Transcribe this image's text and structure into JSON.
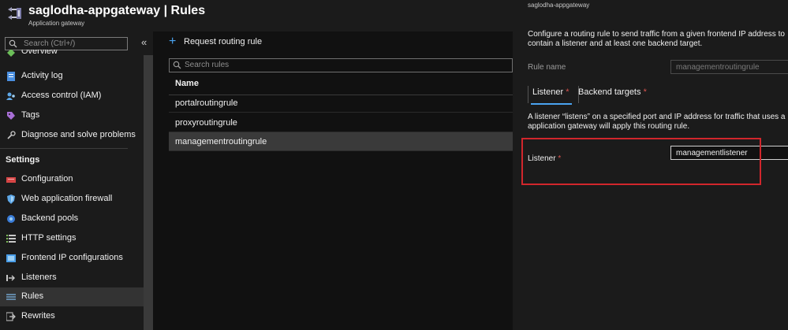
{
  "header": {
    "title": "saglodha-appgateway | Rules",
    "subtitle": "Application gateway"
  },
  "sidebar": {
    "search_placeholder": "Search (Ctrl+/)",
    "collapse_glyph": "«",
    "items": [
      {
        "label": "Overview",
        "icon": "overview-icon"
      },
      {
        "label": "Activity log",
        "icon": "activity-log-icon"
      },
      {
        "label": "Access control (IAM)",
        "icon": "iam-icon"
      },
      {
        "label": "Tags",
        "icon": "tag-icon"
      },
      {
        "label": "Diagnose and solve problems",
        "icon": "wrench-icon"
      }
    ],
    "settings_heading": "Settings",
    "settings_items": [
      {
        "label": "Configuration",
        "icon": "configuration-icon"
      },
      {
        "label": "Web application firewall",
        "icon": "shield-icon"
      },
      {
        "label": "Backend pools",
        "icon": "backend-pool-icon"
      },
      {
        "label": "HTTP settings",
        "icon": "list-settings-icon"
      },
      {
        "label": "Frontend IP configurations",
        "icon": "frontend-ip-icon"
      },
      {
        "label": "Listeners",
        "icon": "listener-icon"
      },
      {
        "label": "Rules",
        "icon": "rules-icon",
        "active": true
      },
      {
        "label": "Rewrites",
        "icon": "rewrite-icon"
      }
    ]
  },
  "main": {
    "add_button_label": "Request routing rule",
    "search_placeholder": "Search rules",
    "column_name": "Name",
    "rows": [
      {
        "name": "portalroutingrule"
      },
      {
        "name": "proxyroutingrule"
      },
      {
        "name": "managementroutingrule",
        "selected": true
      }
    ]
  },
  "panel": {
    "subtitle": "saglodha-appgateway",
    "description_line1": "Configure a routing rule to send traffic from a given frontend IP address to",
    "description_line2": "contain a listener and at least one backend target.",
    "rule_name_label": "Rule name",
    "rule_name_value": "managementroutingrule",
    "tab_listener": "Listener",
    "tab_backend": "Backend targets",
    "required_marker": "*",
    "listener_desc_line1": "A listener “listens” on a specified port and IP address for traffic that uses a",
    "listener_desc_line2": "application gateway will apply this routing rule.",
    "listener_label": "Listener",
    "listener_value": "managementlistener"
  },
  "colors": {
    "accent": "#4aa3f0",
    "highlight": "#d1262c",
    "required": "#d9534f"
  }
}
